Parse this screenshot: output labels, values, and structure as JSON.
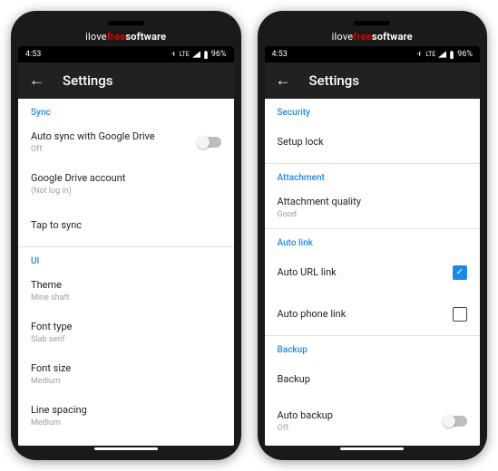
{
  "brand": {
    "pre": "ilove",
    "mid": "free",
    "post": "software"
  },
  "status": {
    "time": "4:53",
    "net": "LTE",
    "signal": "▲",
    "battery": "96%"
  },
  "appbar": {
    "title": "Settings"
  },
  "left": {
    "sync_header": "Sync",
    "auto_sync_title": "Auto sync with Google Drive",
    "auto_sync_sub": "Off",
    "gdrive_title": "Google Drive account",
    "gdrive_sub": "(Not log in)",
    "tap_sync": "Tap to sync",
    "ui_header": "UI",
    "theme_title": "Theme",
    "theme_sub": "Mine shaft",
    "font_type_title": "Font type",
    "font_type_sub": "Slab serif",
    "font_size_title": "Font size",
    "font_size_sub": "Medium",
    "line_spacing_title": "Line spacing",
    "line_spacing_sub": "Medium"
  },
  "right": {
    "security_header": "Security",
    "setup_lock": "Setup lock",
    "attachment_header": "Attachment",
    "att_quality_title": "Attachment quality",
    "att_quality_sub": "Good",
    "autolink_header": "Auto link",
    "auto_url": "Auto URL link",
    "auto_phone": "Auto phone link",
    "backup_header": "Backup",
    "backup": "Backup",
    "auto_backup_title": "Auto backup",
    "auto_backup_sub": "Off"
  }
}
